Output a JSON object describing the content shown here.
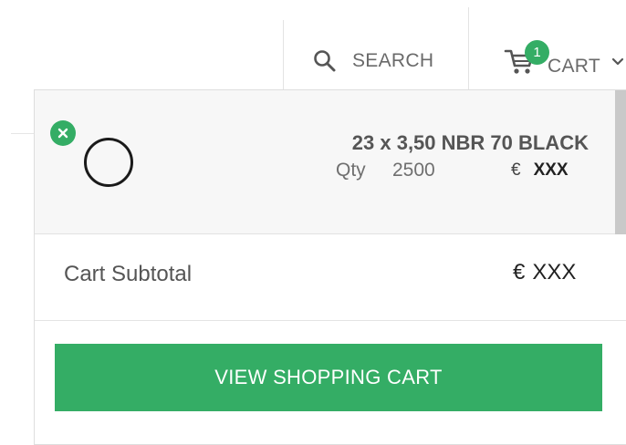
{
  "header": {
    "search_label": "SEARCH",
    "search_icon": "search-icon",
    "cart_label": "CART",
    "cart_icon": "shopping-cart-icon",
    "cart_count": "1",
    "cart_caret_icon": "chevron-down-icon"
  },
  "minicart": {
    "items": [
      {
        "name": "23 x 3,50 NBR 70 BLACK",
        "qty_label": "Qty",
        "qty": "2500",
        "currency": "€",
        "price": "XXX",
        "remove_icon": "close-icon",
        "thumbnail": "o-ring"
      }
    ],
    "subtotal_label": "Cart Subtotal",
    "subtotal_currency": "€",
    "subtotal_value": "XXX",
    "view_cart_label": "VIEW SHOPPING CART"
  },
  "colors": {
    "accent": "#34ad65",
    "text": "#555555",
    "item_bg": "#f7f7f7",
    "scrollbar": "#c9c9c9"
  }
}
